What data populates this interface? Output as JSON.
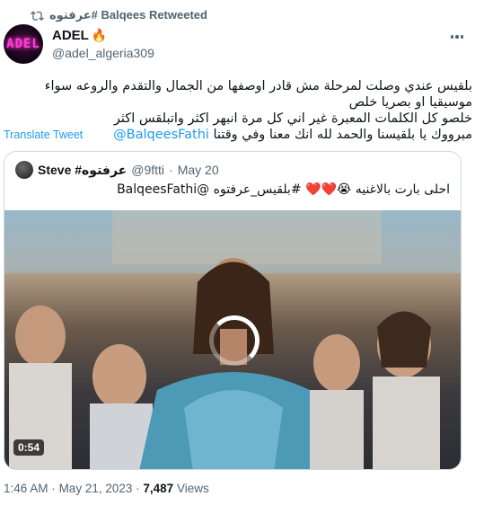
{
  "retweet": {
    "label": "عرفتوه# Balqees Retweeted"
  },
  "author": {
    "name": "ADEL",
    "name_emoji": "🔥",
    "handle": "@adel_algeria309",
    "avatar_text": "ADEL"
  },
  "tweet": {
    "text_line1": "بلقيس عندي وصلت لمرحلة مش قادر اوصفها من الجمال والتقدم والروعه سواء موسيقيا او بصريا خلص",
    "text_line2": "خلصو كل الكلمات المعبرة غير اني كل مرة انبهر اكثر واتبلقس اكثر",
    "text_line3": "مبرووك يا بلقيسنا والحمد لله انك معنا وفي وقتنا",
    "mention": "@BalqeesFathi"
  },
  "translate_label": "Translate Tweet",
  "quote": {
    "name": "Steve #عرفتوه",
    "handle": "@9ftti",
    "date": "May 20",
    "text": "احلى بارت بالاغنيه 😭❤️❤️ #بلقيس_عرفتوه @BalqeesFathi",
    "video_duration": "0:54"
  },
  "footer": {
    "time": "1:46 AM",
    "date": "May 21, 2023",
    "views_count": "7,487",
    "views_label": "Views",
    "sep": "·"
  },
  "colors": {
    "accent": "#1d9bf0",
    "muted": "#536471",
    "border": "#cfd9de"
  },
  "icons": {
    "retweet": "retweet-icon",
    "more": "more-horizontal-icon"
  }
}
